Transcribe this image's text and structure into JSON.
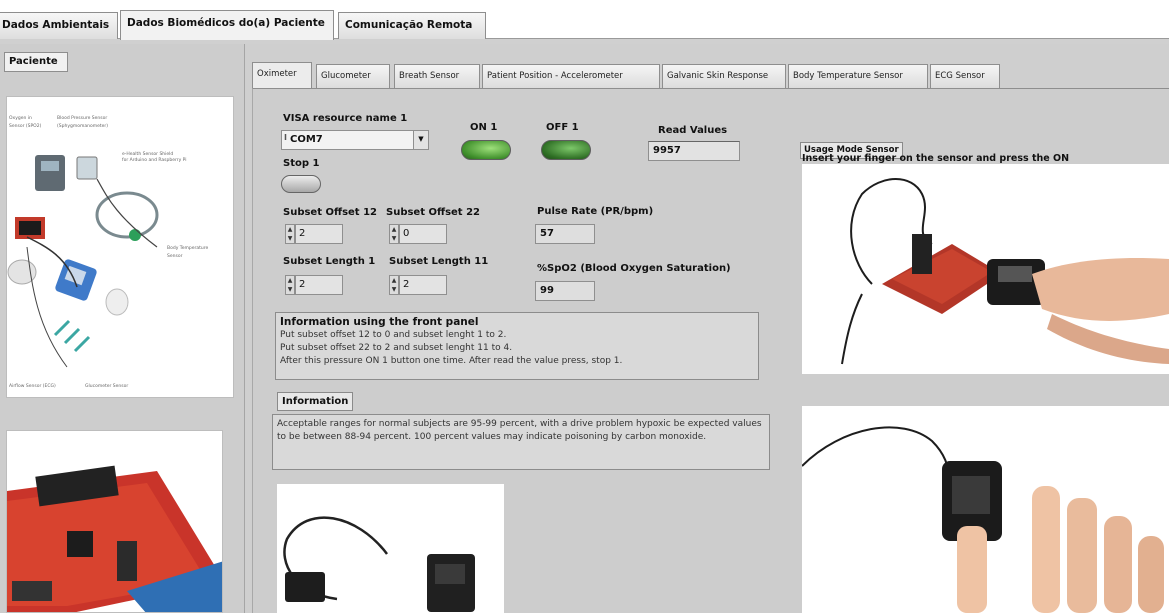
{
  "top_tabs": [
    {
      "label": "Dados Ambientais",
      "active": false
    },
    {
      "label": "Dados Biomédicos do(a) Paciente",
      "active": true
    },
    {
      "label": "Comunicação Remota",
      "active": false
    }
  ],
  "left_panel": {
    "paciente_tab": "Paciente",
    "diagram_labels": [
      "Oxygen in",
      "Blood Pressure Sensor",
      "Sensor (SPO2)",
      "(Sphygmomanometer)",
      "e-Health Sensor Shield",
      "for Arduino and Raspberry Pi",
      "Body Temperature",
      "Sensor",
      "Airflow Sensor (ECG)",
      "Glucometer Sensor"
    ]
  },
  "sensor_tabs": [
    "Oximeter",
    "Glucometer",
    "Breath Sensor",
    "Patient Position - Accelerometer",
    "Galvanic Skin Response",
    "Body Temperature Sensor",
    "ECG Sensor"
  ],
  "controls": {
    "visa_label": "VISA resource name 1",
    "visa_value": "COM7",
    "on_label": "ON 1",
    "off_label": "OFF 1",
    "read_values_label": "Read Values",
    "read_values_value": "9957",
    "stop_label": "Stop 1",
    "subset_offset_12_label": "Subset Offset 12",
    "subset_offset_12_value": "2",
    "subset_offset_22_label": "Subset Offset 22",
    "subset_offset_22_value": "0",
    "subset_length_1_label": "Subset Length 1",
    "subset_length_1_value": "2",
    "subset_length_11_label": "Subset Length 11",
    "subset_length_11_value": "2",
    "pulse_rate_label": "Pulse Rate (PR/bpm)",
    "pulse_rate_value": "57",
    "spo2_label": "%SpO2 (Blood Oxygen Saturation)",
    "spo2_value": "99"
  },
  "front_panel_info": {
    "title": "Information using the front panel",
    "lines": [
      "Put subset offset 12 to 0 and subset lenght 1 to 2.",
      "Put subset offset 22 to 2 and subset lenght 11 to 4.",
      "After this pressure ON 1 button one time. After read the value press, stop 1."
    ]
  },
  "information": {
    "label": "Information",
    "text": "Acceptable ranges for normal subjects are 95-99 percent, with a drive problem hypoxic be expected values to be between 88-94 percent. 100 percent values may indicate poisoning by carbon monoxide."
  },
  "usage": {
    "button_label": "Usage Mode Sensor",
    "instruction": "Insert your finger on the sensor and press the ON"
  },
  "colors": {
    "panel_bg": "#cdcdcd",
    "led_green": "#3f8f2b",
    "board_red": "#c23a2a"
  }
}
